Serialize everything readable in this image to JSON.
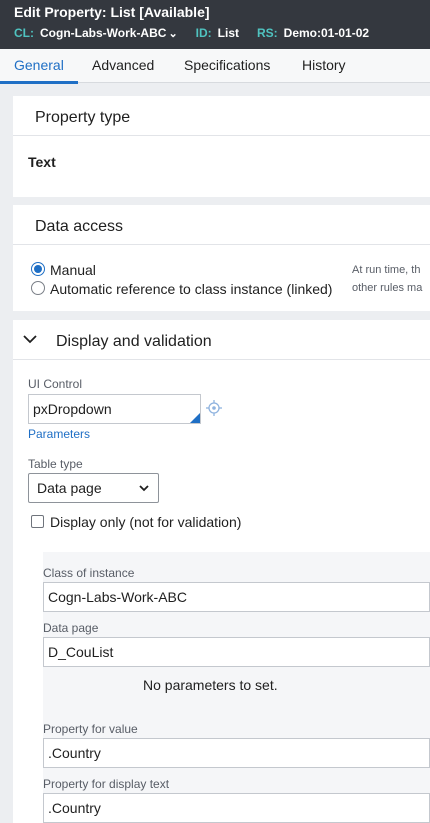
{
  "header": {
    "title": "Edit  Property: List [Available]",
    "meta": [
      {
        "key": "CL:",
        "value": "Cogn-Labs-Work-ABC"
      },
      {
        "key": "ID:",
        "value": "List"
      },
      {
        "key": "RS:",
        "value": "Demo:01-01-02"
      }
    ]
  },
  "tabs": [
    "General",
    "Advanced",
    "Specifications",
    "History"
  ],
  "property_type": {
    "title": "Property type",
    "value": "Text"
  },
  "data_access": {
    "title": "Data access",
    "options": [
      "Manual",
      "Automatic reference to class instance (linked)"
    ],
    "selected": "Manual",
    "help_line1": "At run time, th",
    "help_line2": "other rules ma"
  },
  "display_validation": {
    "title": "Display and validation",
    "ui_control_label": "UI Control",
    "ui_control_value": "pxDropdown",
    "parameters_link": "Parameters",
    "table_type_label": "Table type",
    "table_type_value": "Data page",
    "display_only_label": "Display only (not for validation)",
    "display_only_checked": false,
    "class_label": "Class of instance",
    "class_value": "Cogn-Labs-Work-ABC",
    "data_page_label": "Data page",
    "data_page_value": "D_CouList",
    "no_params": "No parameters to set.",
    "prop_value_label": "Property for value",
    "prop_value": ".Country",
    "prop_display_label": "Property for display text",
    "prop_display": ".Country"
  },
  "colors": {
    "header_bg": "#34383f",
    "meta_key": "#4fc3c0",
    "accent": "#1f6fc5"
  }
}
